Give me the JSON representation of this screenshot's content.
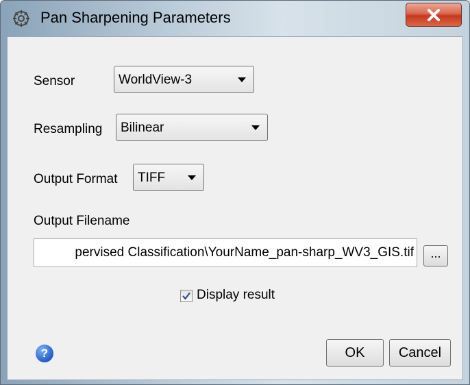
{
  "window": {
    "title": "Pan Sharpening Parameters",
    "title_icon": "gear-icon",
    "close_icon": "close-icon"
  },
  "form": {
    "sensor": {
      "label": "Sensor",
      "value": "WorldView-3"
    },
    "resampling": {
      "label": "Resampling",
      "value": "Bilinear"
    },
    "output_format": {
      "label": "Output Format",
      "value": "TIFF"
    },
    "output_filename": {
      "label": "Output Filename",
      "value": "pervised Classification\\YourName_pan-sharp_WV3_GIS.tif",
      "browse_label": "..."
    },
    "display_result": {
      "label": "Display result",
      "checked": true
    }
  },
  "footer": {
    "help_icon": "help-icon",
    "help_glyph": "?",
    "ok_label": "OK",
    "cancel_label": "Cancel"
  },
  "colors": {
    "close_button": "#c3391f",
    "help_icon": "#2a62c9"
  }
}
